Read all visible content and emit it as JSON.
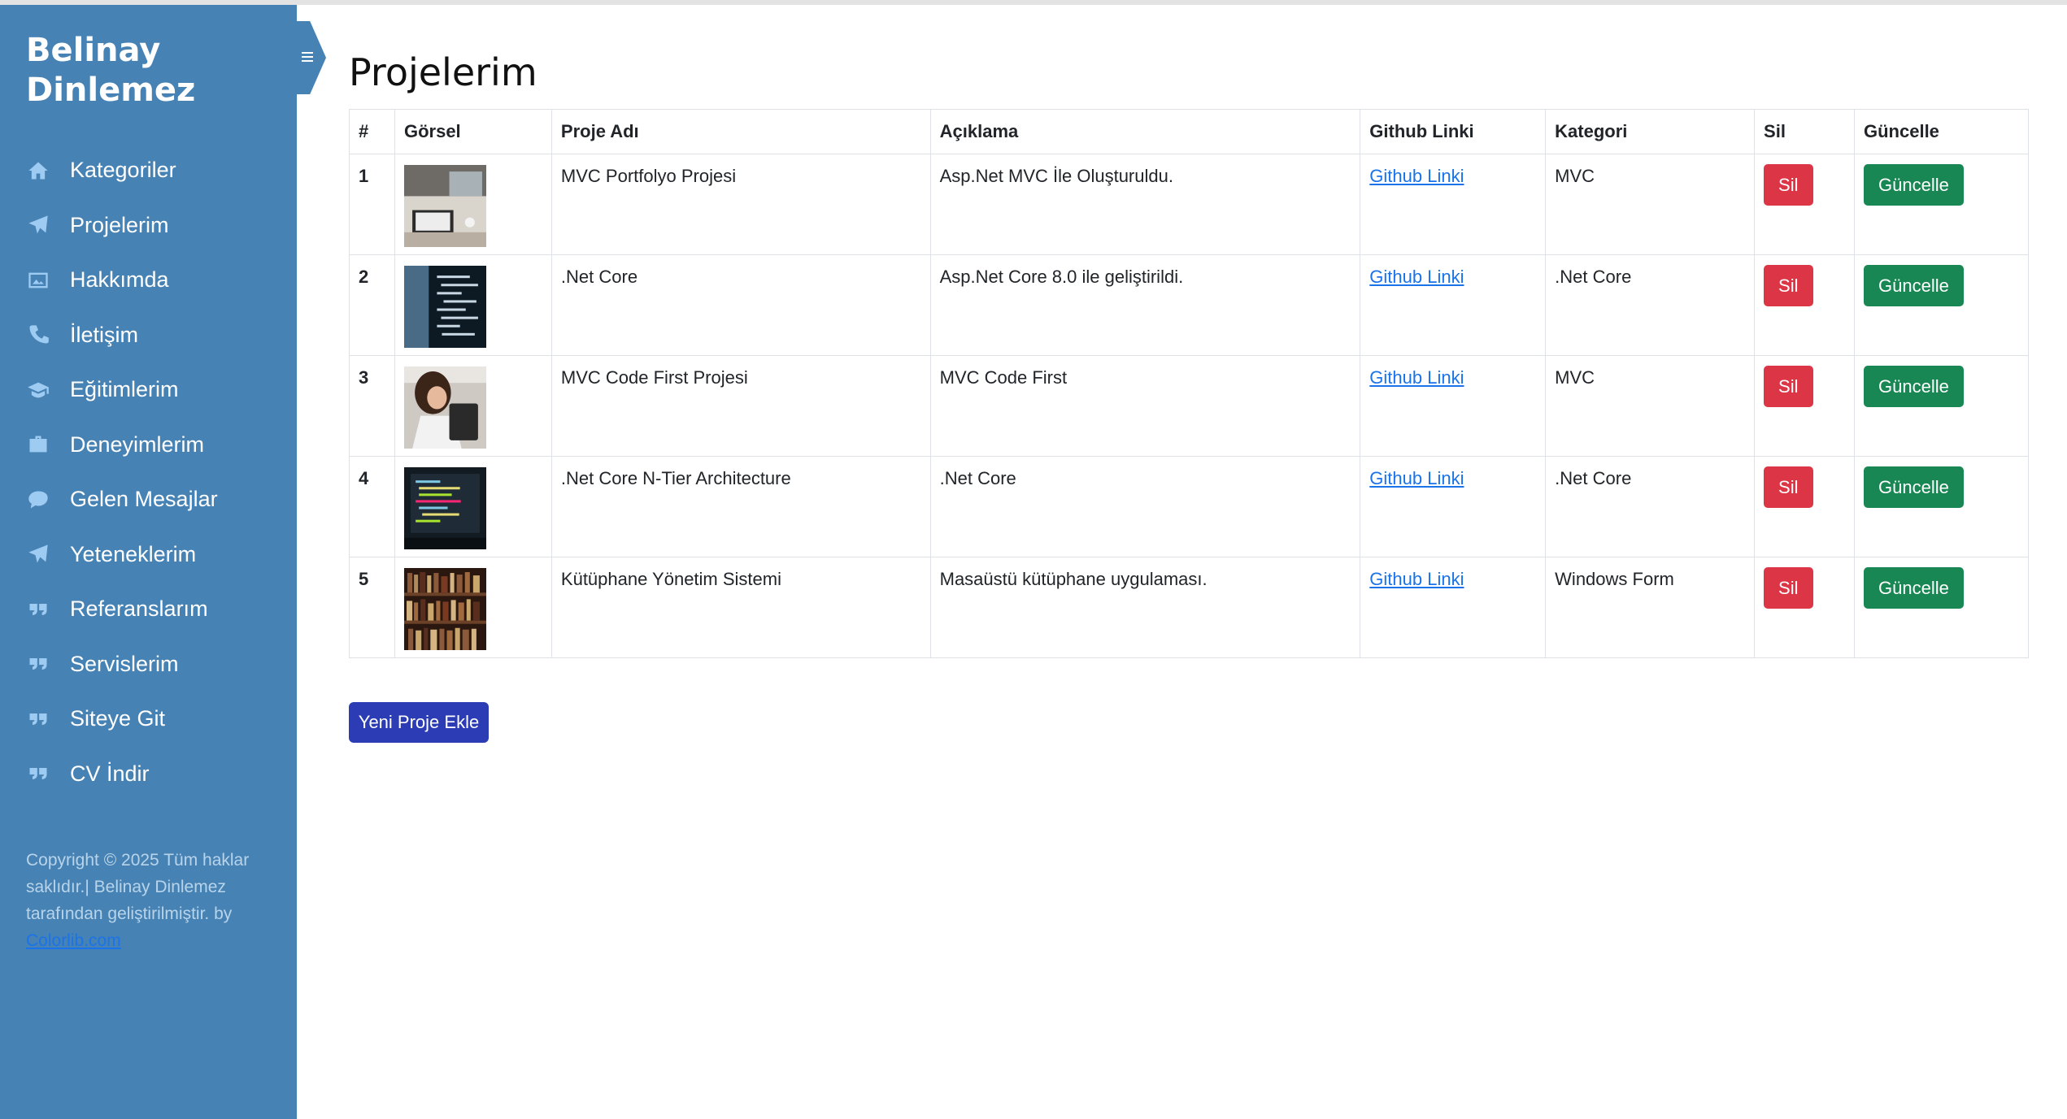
{
  "sidebar": {
    "brand": "Belinay Dinlemez",
    "items": [
      {
        "label": "Kategoriler",
        "icon": "home-icon"
      },
      {
        "label": "Projelerim",
        "icon": "paper-plane-icon"
      },
      {
        "label": "Hakkımda",
        "icon": "image-icon"
      },
      {
        "label": "İletişim",
        "icon": "phone-icon"
      },
      {
        "label": "Eğitimlerim",
        "icon": "graduation-cap-icon"
      },
      {
        "label": "Deneyimlerim",
        "icon": "briefcase-icon"
      },
      {
        "label": "Gelen Mesajlar",
        "icon": "chat-bubble-icon"
      },
      {
        "label": "Yeteneklerim",
        "icon": "paper-plane-icon"
      },
      {
        "label": "Referanslarım",
        "icon": "quote-icon"
      },
      {
        "label": "Servislerim",
        "icon": "quote-icon"
      },
      {
        "label": "Siteye Git",
        "icon": "quote-icon"
      },
      {
        "label": "CV İndir",
        "icon": "quote-icon"
      }
    ],
    "footer_text": "Copyright © 2025 Tüm haklar saklıdır.| Belinay Dinlemez tarafından geliştirilmiştir. by",
    "footer_link": "Colorlib.com"
  },
  "page": {
    "title": "Projelerim"
  },
  "table": {
    "headers": [
      "#",
      "Görsel",
      "Proje Adı",
      "Açıklama",
      "Github Linki",
      "Kategori",
      "Sil",
      "Güncelle"
    ],
    "rows": [
      {
        "num": "1",
        "image": "desk-laptop-photo",
        "name": "MVC Portfolyo Projesi",
        "desc": "Asp.Net MVC İle Oluşturuldu.",
        "github": "Github Linki",
        "category": "MVC",
        "delete": "Sil",
        "update": "Güncelle"
      },
      {
        "num": "2",
        "image": "code-screen-photo",
        "name": ".Net Core",
        "desc": "Asp.Net Core 8.0 ile geliştirildi.",
        "github": "Github Linki",
        "category": ".Net Core",
        "delete": "Sil",
        "update": "Güncelle"
      },
      {
        "num": "3",
        "image": "woman-laptop-photo",
        "name": "MVC Code First Projesi",
        "desc": "MVC Code First",
        "github": "Github Linki",
        "category": "MVC",
        "delete": "Sil",
        "update": "Güncelle"
      },
      {
        "num": "4",
        "image": "code-monitor-photo",
        "name": ".Net Core N-Tier Architecture",
        "desc": ".Net Core",
        "github": "Github Linki",
        "category": ".Net Core",
        "delete": "Sil",
        "update": "Güncelle"
      },
      {
        "num": "5",
        "image": "bookshelf-photo",
        "name": "Kütüphane Yönetim Sistemi",
        "desc": "Masaüstü kütüphane uygulaması.",
        "github": "Github Linki",
        "category": "Windows Form",
        "delete": "Sil",
        "update": "Güncelle"
      }
    ]
  },
  "add_button": "Yeni Proje Ekle",
  "colors": {
    "sidebar": "#4682b4",
    "danger": "#dc3545",
    "success": "#198754",
    "primary": "#2c3cb5",
    "link": "#1a73e8"
  }
}
